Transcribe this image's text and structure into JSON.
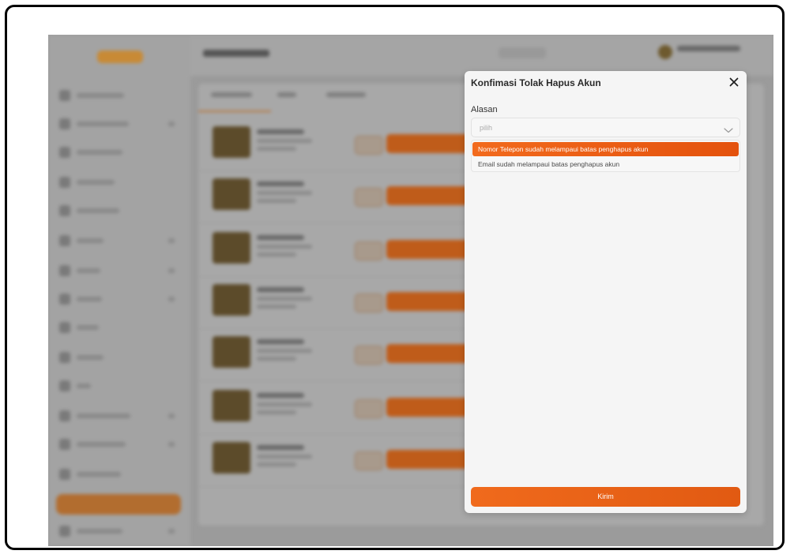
{
  "modal": {
    "title": "Konfimasi Tolak Hapus Akun",
    "field_label": "Alasan",
    "select_placeholder": "pilih",
    "options": [
      {
        "label": "Nomor Telepon sudah melampaui batas penghapus akun",
        "selected": true
      },
      {
        "label": "Email sudah melampaui batas penghapus akun",
        "selected": false
      }
    ],
    "submit_label": "Kirim"
  },
  "colors": {
    "accent": "#ee6418",
    "overlay": "#9b9b9b",
    "modal_bg": "#f5f5f5"
  },
  "icons": {
    "close": "close-icon",
    "chevron": "chevron-down-icon"
  }
}
